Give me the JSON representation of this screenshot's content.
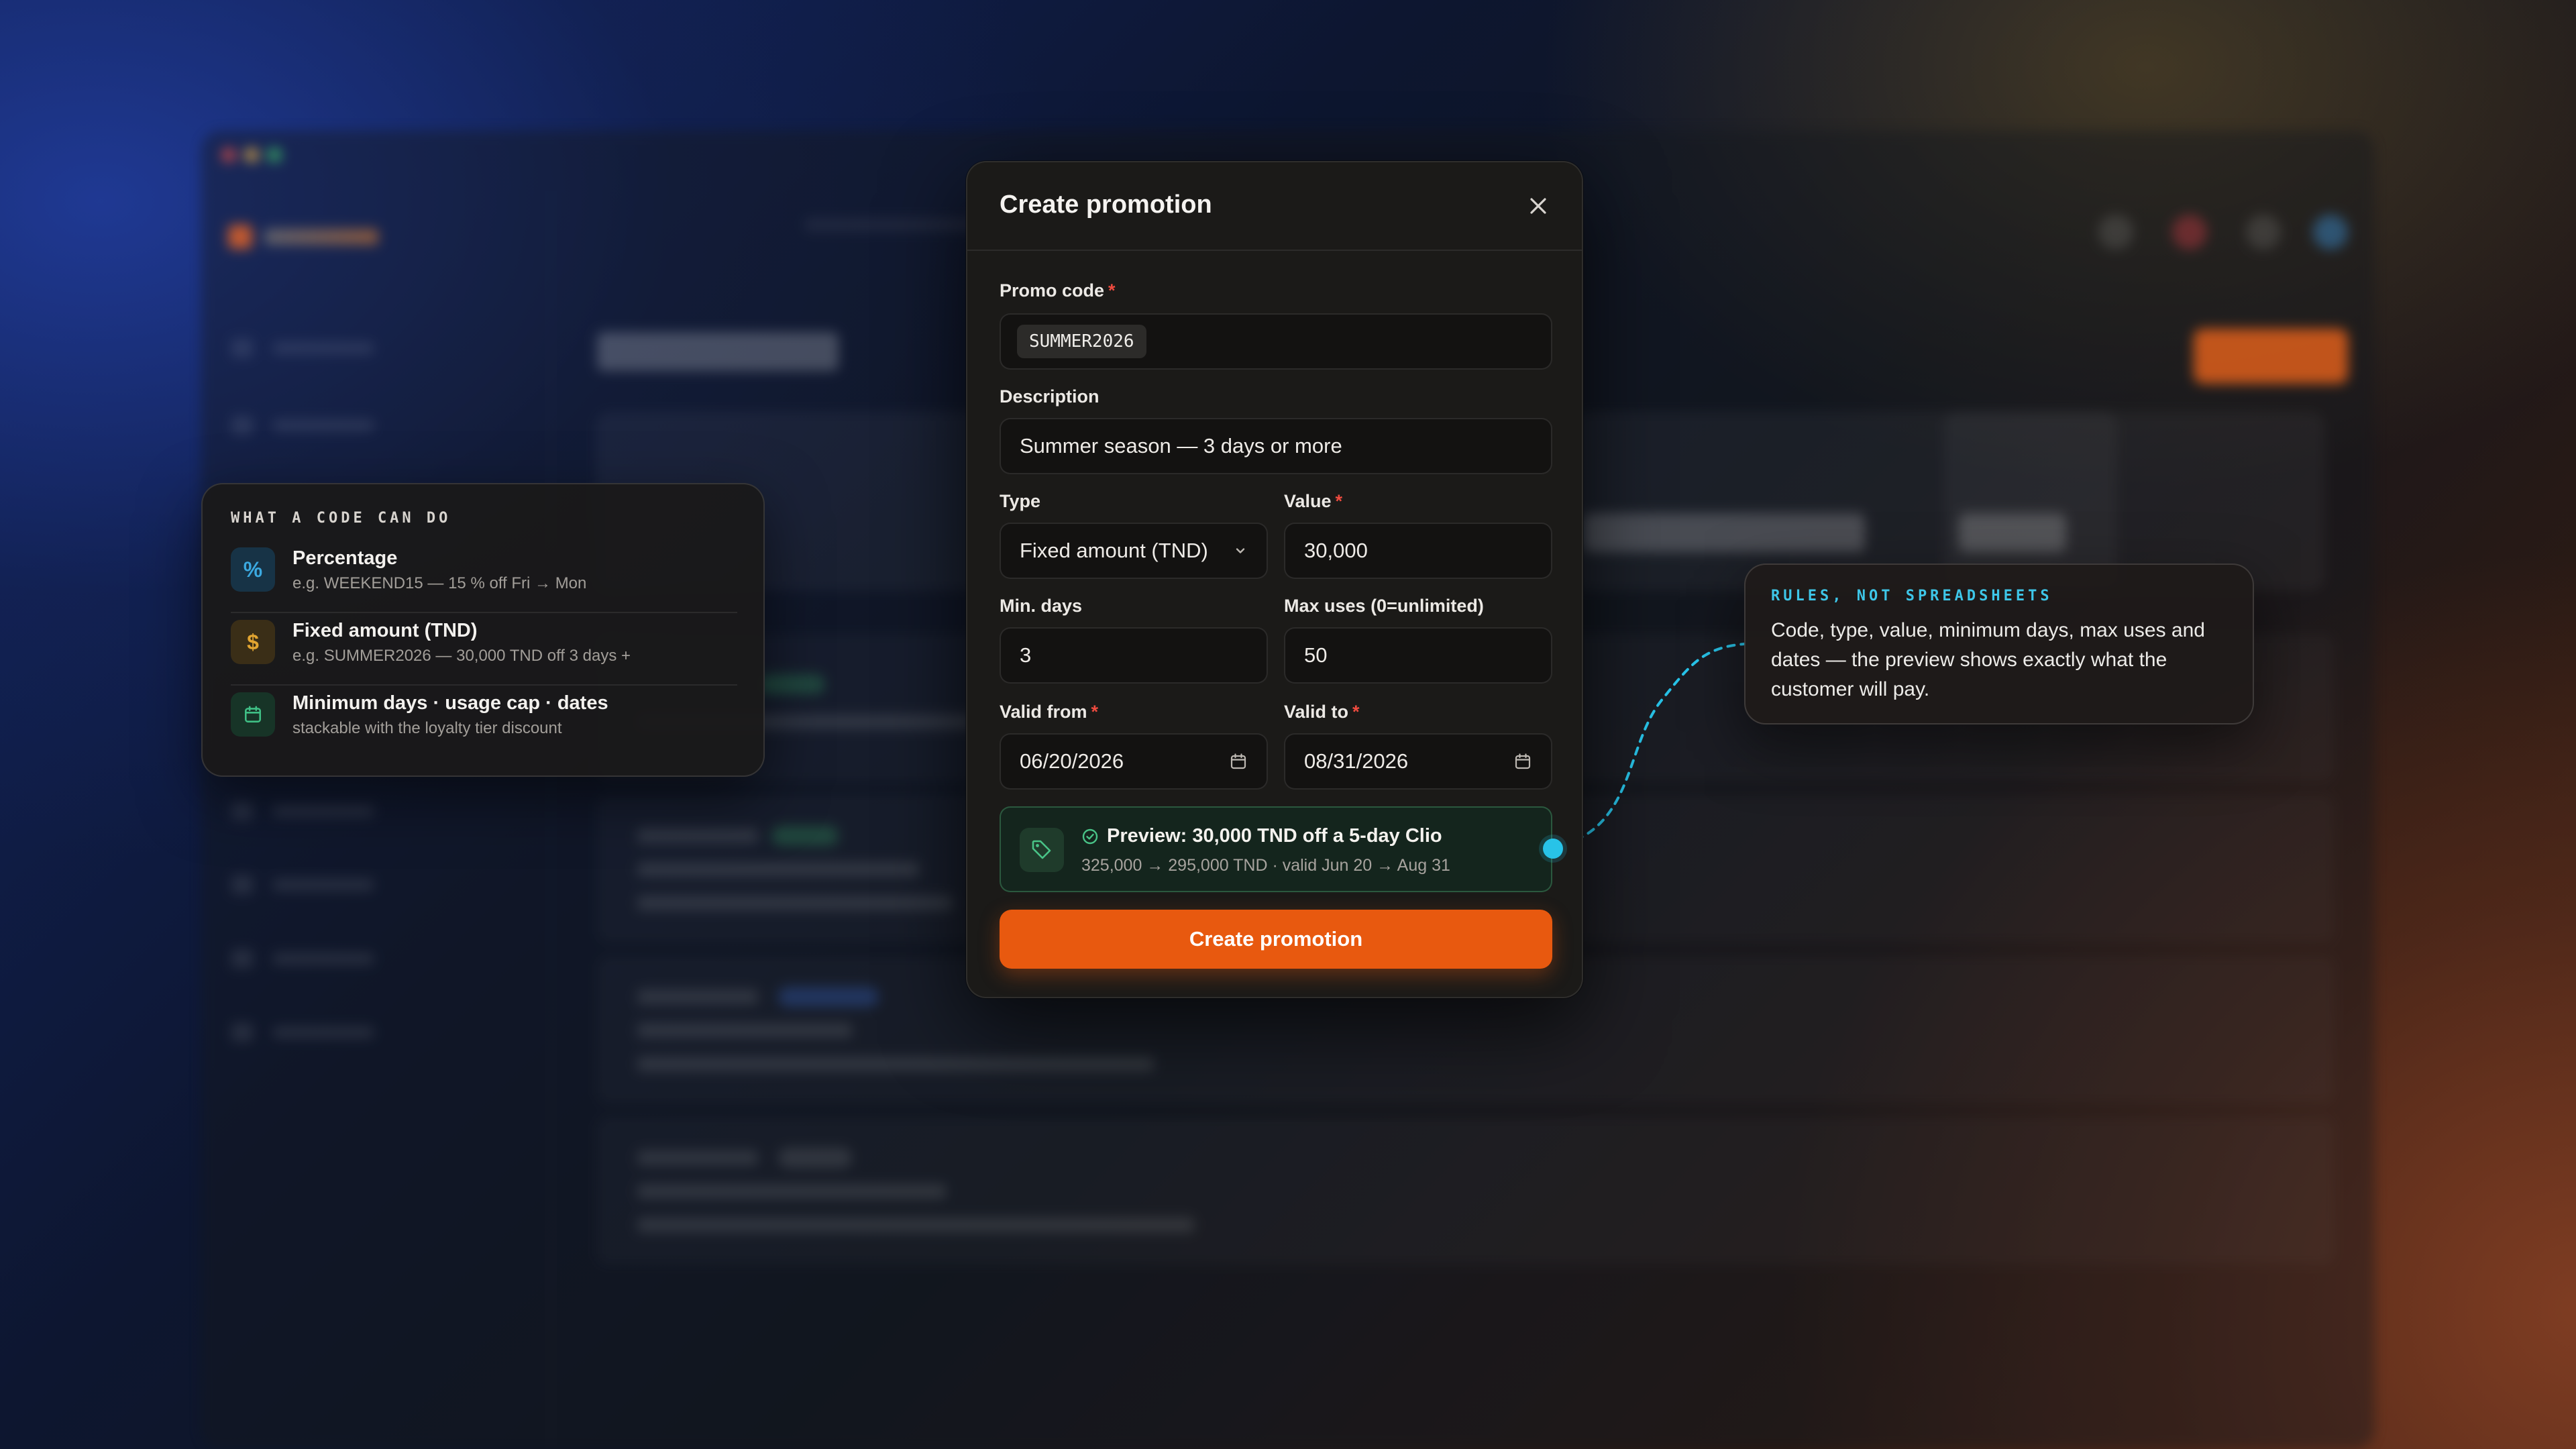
{
  "modal": {
    "title": "Create promotion",
    "promo_code": {
      "label": "Promo code",
      "required_mark": "*",
      "value": "SUMMER2026"
    },
    "description": {
      "label": "Description",
      "value": "Summer season — 3 days or more"
    },
    "type": {
      "label": "Type",
      "selected": "Fixed amount (TND)"
    },
    "value": {
      "label": "Value",
      "required_mark": "*",
      "value": "30,000"
    },
    "min_days": {
      "label": "Min. days",
      "value": "3"
    },
    "max_uses": {
      "label": "Max uses (0=unlimited)",
      "value": "50"
    },
    "valid_from": {
      "label": "Valid from",
      "required_mark": "*",
      "value": "06/20/2026"
    },
    "valid_to": {
      "label": "Valid to",
      "required_mark": "*",
      "value": "08/31/2026"
    },
    "preview": {
      "title": "Preview: 30,000 TND off a 5-day Clio",
      "subtitle": "325,000 → 295,000 TND · valid Jun 20 → Aug 31"
    },
    "submit_label": "Create promotion"
  },
  "info_card": {
    "heading": "WHAT A CODE CAN DO",
    "items": [
      {
        "icon": "percent-icon",
        "glyph": "%",
        "title": "Percentage",
        "subtitle": "e.g. WEEKEND15 — 15 % off Fri → Mon",
        "color": "#3ba9e0"
      },
      {
        "icon": "dollar-icon",
        "glyph": "$",
        "title": "Fixed amount (TND)",
        "subtitle": "e.g. SUMMER2026 — 30,000 TND off 3 days +",
        "color": "#e2a531"
      },
      {
        "icon": "calendar-icon",
        "glyph": "",
        "title": "Minimum days · usage cap · dates",
        "subtitle": "stackable with the loyalty tier discount",
        "color": "#3fbf85"
      }
    ]
  },
  "callout": {
    "heading": "RULES, NOT SPREADSHEETS",
    "body": "Code, type, value, minimum days, max uses and dates — the preview shows exactly what the customer will pay."
  },
  "colors": {
    "accent": "#e8590f",
    "cyan": "#28c3e8",
    "success": "#3fbf85"
  }
}
